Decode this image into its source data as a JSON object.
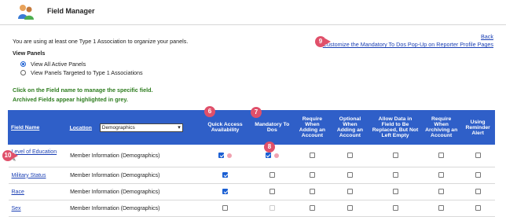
{
  "header": {
    "title": "Field Manager",
    "logo_icon": "users-icon"
  },
  "intro_text": "You are using at least one Type 1 Association to organize your panels.",
  "links": {
    "back": "Back",
    "customize": "Customize the Mandatory To Dos Pop-Up on Reporter Profile Pages"
  },
  "view_panels": {
    "label": "View Panels",
    "options": [
      {
        "label": "View All Active Panels",
        "selected": true
      },
      {
        "label": "View Panels Targeted to Type 1 Associations",
        "selected": false
      }
    ]
  },
  "notes": [
    "Click on the Field name to manage the specific field.",
    "Archived Fields appear highlighted in grey."
  ],
  "table": {
    "headers": {
      "field_name": "Field Name",
      "location": "Location",
      "location_select": "Demographics",
      "quick_access": "Quick Access Availability",
      "mandatory": "Mandatory To Dos",
      "req_adding": "Require When Adding an Account",
      "opt_adding": "Optional When Adding an Account",
      "allow_data": "Allow Data in Field to Be Replaced, But Not Left Empty",
      "req_archiving": "Require When Archiving an Account",
      "reminder": "Using Reminder Alert"
    },
    "rows": [
      {
        "name": "Level of Education",
        "location": "Member Information (Demographics)",
        "quick": true,
        "mandatory": true,
        "dots": true,
        "edit": true
      },
      {
        "name": "Military Status",
        "location": "Member Information (Demographics)",
        "quick": true,
        "mandatory": false,
        "mandatory_disabled": false
      },
      {
        "name": "Race",
        "location": "Member Information (Demographics)",
        "quick": true,
        "mandatory": false,
        "mandatory_disabled": false
      },
      {
        "name": "Sex",
        "location": "Member Information (Demographics)",
        "quick": false,
        "mandatory": false,
        "mandatory_disabled": true
      }
    ]
  },
  "annotations": {
    "b6": "6",
    "b7": "7",
    "b8": "8",
    "b9": "9",
    "b10": "10"
  },
  "colors": {
    "header_blue": "#2f5fc8",
    "annotation_red": "#e0506a",
    "link_blue": "#1a3fb4",
    "note_green": "#2e7d1f"
  }
}
